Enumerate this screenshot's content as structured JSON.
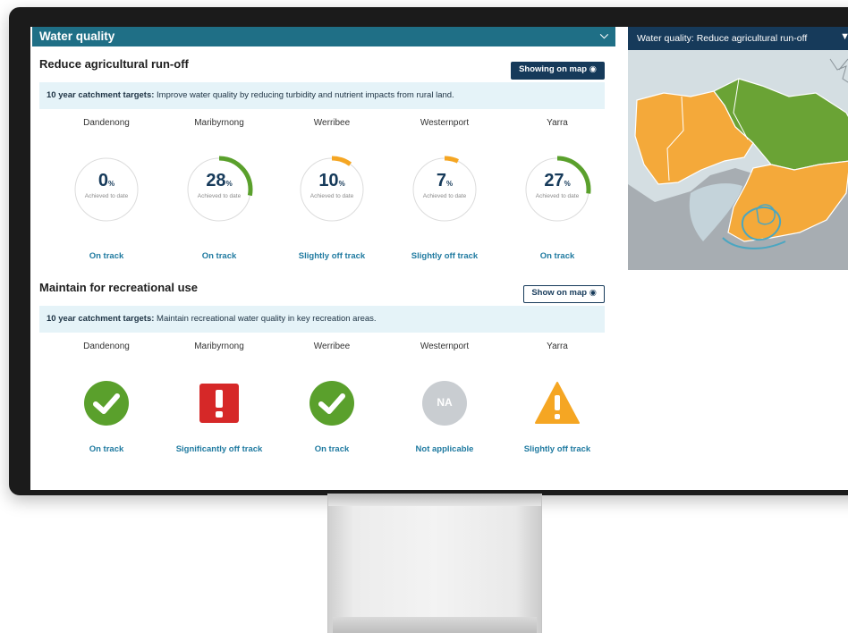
{
  "section": {
    "title": "Water quality"
  },
  "goal1": {
    "title": "Reduce agricultural run-off",
    "map_button": "Showing on map",
    "target_label": "10 year catchment targets:",
    "target_text": "Improve water quality by reducing turbidity and nutrient impacts from rural land.",
    "achieved_label": "Achieved to date",
    "percent_symbol": "%",
    "regions": [
      {
        "name": "Dandenong",
        "value": 0,
        "value_text": "0",
        "status": "On track",
        "arc_color": "#5aa02c"
      },
      {
        "name": "Maribyrnong",
        "value": 28,
        "value_text": "28",
        "status": "On track",
        "arc_color": "#5aa02c"
      },
      {
        "name": "Werribee",
        "value": 10,
        "value_text": "10",
        "status": "Slightly off track",
        "arc_color": "#f5a623"
      },
      {
        "name": "Westernport",
        "value": 7,
        "value_text": "7",
        "status": "Slightly off track",
        "arc_color": "#f5a623"
      },
      {
        "name": "Yarra",
        "value": 27,
        "value_text": "27",
        "status": "On track",
        "arc_color": "#5aa02c"
      }
    ]
  },
  "goal2": {
    "title": "Maintain for recreational use",
    "map_button": "Show on map",
    "target_label": "10 year catchment targets:",
    "target_text": "Maintain recreational water quality in key recreation areas.",
    "regions": [
      {
        "name": "Dandenong",
        "icon": "check-circle-icon",
        "status": "On track"
      },
      {
        "name": "Maribyrnong",
        "icon": "exclamation-square-icon",
        "status": "Significantly off track"
      },
      {
        "name": "Werribee",
        "icon": "check-circle-icon",
        "status": "On track"
      },
      {
        "name": "Westernport",
        "icon": "na-circle-icon",
        "icon_text": "NA",
        "status": "Not applicable"
      },
      {
        "name": "Yarra",
        "icon": "warning-triangle-icon",
        "status": "Slightly off track"
      }
    ]
  },
  "map": {
    "title": "Water quality: Reduce agricultural run-off"
  },
  "colors": {
    "section_bar": "#1f6f86",
    "navy": "#163a5a",
    "on_track": "#5aa02c",
    "off_track": "#f5a623",
    "danger": "#d62828",
    "na_grey": "#c9cdd1",
    "status_text": "#1f7aa0"
  }
}
